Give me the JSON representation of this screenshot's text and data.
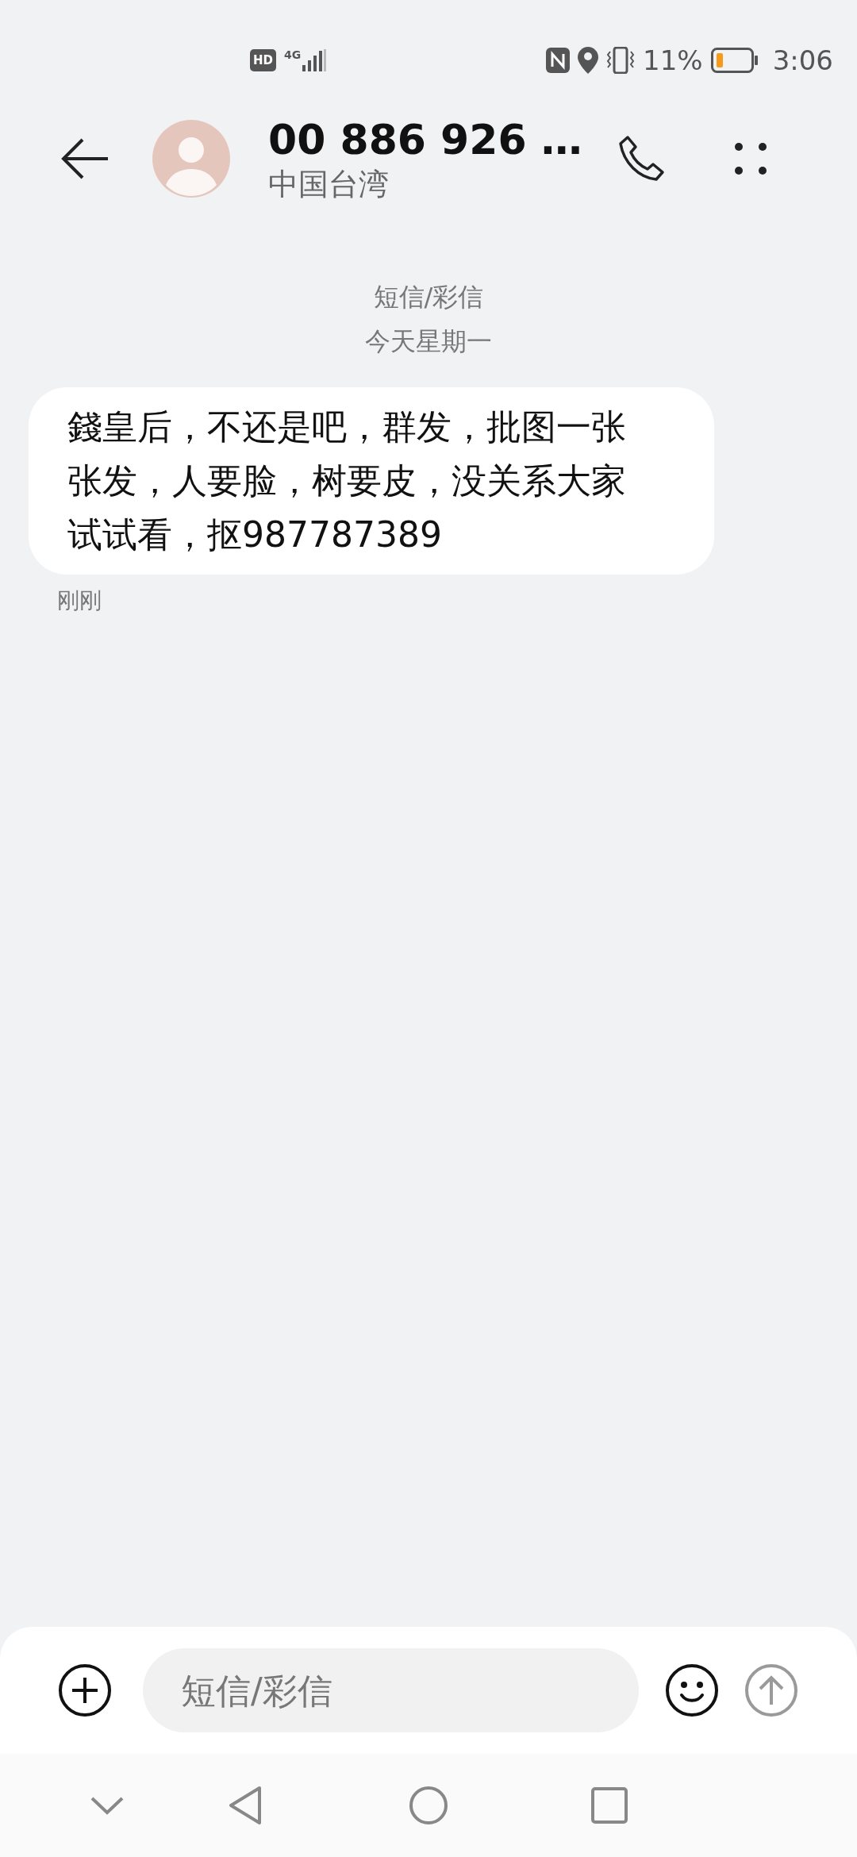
{
  "status_bar": {
    "hd_badge": "HD",
    "network": "4G",
    "battery": "11%",
    "time": "3:06"
  },
  "header": {
    "title": "00 886 926 …",
    "subtitle": "中国台湾"
  },
  "thread": {
    "channel": "短信/彩信",
    "date": "今天星期一"
  },
  "messages": [
    {
      "text": "錢皇后，不还是吧，群发，批图一张张发，人要脸，树要皮，没关系大家试试看，抠987787389",
      "time": "刚刚"
    }
  ],
  "composer": {
    "placeholder": "短信/彩信"
  }
}
